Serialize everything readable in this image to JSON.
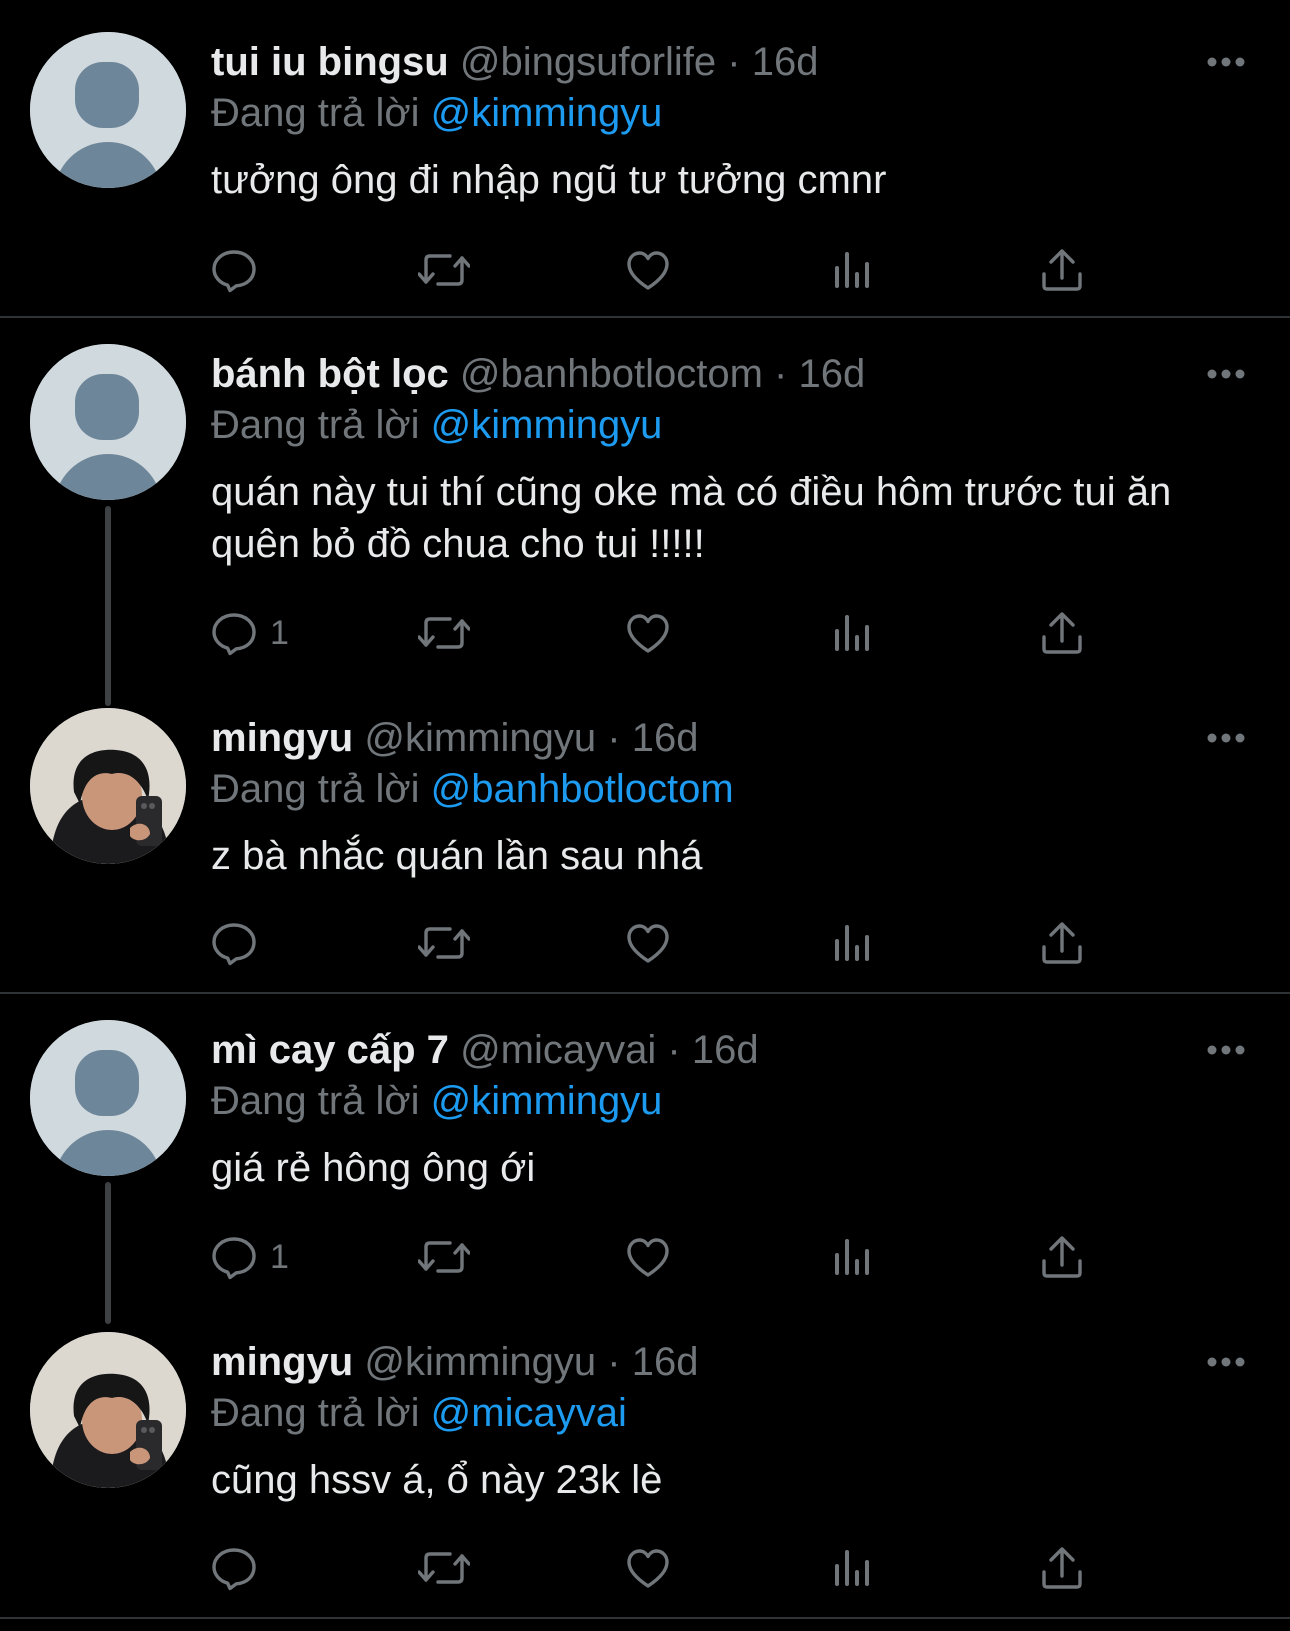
{
  "colors": {
    "background": "#000000",
    "text": "#e7e9ea",
    "muted": "#71767b",
    "link": "#1d9bf0",
    "divider": "#2f3336"
  },
  "replying_prefix": "Đang trả lời",
  "tweets": [
    {
      "name": "tui iu bingsu",
      "handle": "@bingsuforlife",
      "dot": "·",
      "time": "16d",
      "reply_to": "@kimmingyu",
      "text": "tưởng ông đi nhập ngũ tư tưởng cmnr",
      "reply_count": "",
      "avatar": "default-avatar"
    },
    {
      "name": "bánh bột lọc",
      "handle": "@banhbotloctom",
      "dot": "·",
      "time": "16d",
      "reply_to": "@kimmingyu",
      "text": "quán này tui thí cũng oke mà có điều hôm trước tui ăn quên bỏ đồ chua cho tui !!!!!",
      "reply_count": "1",
      "avatar": "default-avatar"
    },
    {
      "name": "mingyu",
      "handle": "@kimmingyu",
      "dot": "·",
      "time": "16d",
      "reply_to": "@banhbotloctom",
      "text": "z bà nhắc quán lần sau nhá",
      "reply_count": "",
      "avatar": "photo-avatar"
    },
    {
      "name": "mì cay cấp 7",
      "handle": "@micayvai",
      "dot": "·",
      "time": "16d",
      "reply_to": "@kimmingyu",
      "text": "giá rẻ hông ông ới",
      "reply_count": "1",
      "avatar": "default-avatar"
    },
    {
      "name": "mingyu",
      "handle": "@kimmingyu",
      "dot": "·",
      "time": "16d",
      "reply_to": "@micayvai",
      "text": "cũng hssv á, ổ này 23k lè",
      "reply_count": "",
      "avatar": "photo-avatar"
    }
  ],
  "action_icons": [
    "reply-icon",
    "retweet-icon",
    "like-icon",
    "views-icon",
    "share-icon"
  ]
}
